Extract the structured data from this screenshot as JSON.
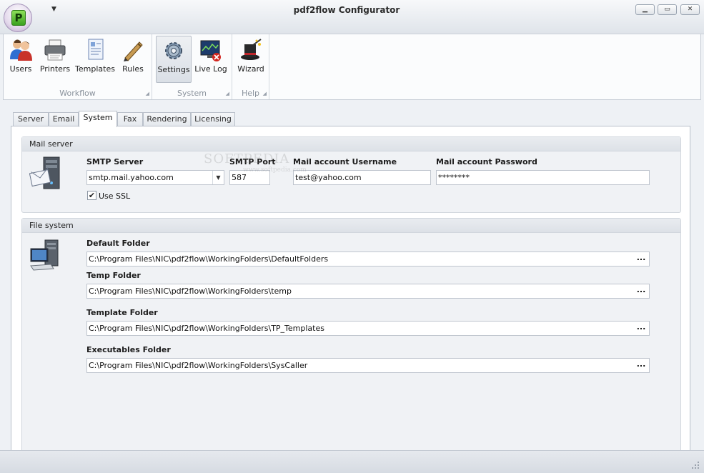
{
  "window": {
    "title": "pdf2flow Configurator",
    "logo_letter": "P",
    "controls": [
      "minimize",
      "maximize",
      "close"
    ]
  },
  "ribbon": {
    "groups": [
      {
        "label": "Workflow",
        "buttons": [
          {
            "label": "Users",
            "icon": "users-icon"
          },
          {
            "label": "Printers",
            "icon": "printer-icon"
          },
          {
            "label": "Templates",
            "icon": "template-icon"
          },
          {
            "label": "Rules",
            "icon": "pen-icon"
          }
        ]
      },
      {
        "label": "System",
        "buttons": [
          {
            "label": "Settings",
            "icon": "gear-icon",
            "active": true
          },
          {
            "label": "Live Log",
            "icon": "log-monitor-icon"
          }
        ]
      },
      {
        "label": "Help",
        "buttons": [
          {
            "label": "Wizard",
            "icon": "magic-hat-icon"
          }
        ]
      }
    ]
  },
  "tabs": [
    "Server",
    "Email",
    "System",
    "Fax",
    "Rendering",
    "Licensing"
  ],
  "active_tab": "System",
  "mail_server": {
    "header": "Mail server",
    "smtp_server_label": "SMTP Server",
    "smtp_server_value": "smtp.mail.yahoo.com",
    "smtp_port_label": "SMTP Port",
    "smtp_port_value": "587",
    "username_label": "Mail account Username",
    "username_value": "test@yahoo.com",
    "password_label": "Mail account Password",
    "password_value": "********",
    "use_ssl_label": "Use SSL",
    "use_ssl_checked": true
  },
  "file_system": {
    "header": "File system",
    "default_folder_label": "Default Folder",
    "default_folder_value": "C:\\Program Files\\NIC\\pdf2flow\\WorkingFolders\\DefaultFolders",
    "temp_folder_label": "Temp Folder",
    "temp_folder_value": "C:\\Program Files\\NIC\\pdf2flow\\WorkingFolders\\temp",
    "template_folder_label": "Template Folder",
    "template_folder_value": "C:\\Program Files\\NIC\\pdf2flow\\WorkingFolders\\TP_Templates",
    "executables_folder_label": "Executables Folder",
    "executables_folder_value": "C:\\Program Files\\NIC\\pdf2flow\\WorkingFolders\\SysCaller",
    "browse_label": "..."
  },
  "watermark": {
    "text": "SOFTPEDIA",
    "sub": "www.softpedia.com"
  },
  "colors": {
    "accent_green": "#3ba11f",
    "orb_purple": "#b9a6c9",
    "header_grey": "#dde1e7"
  }
}
